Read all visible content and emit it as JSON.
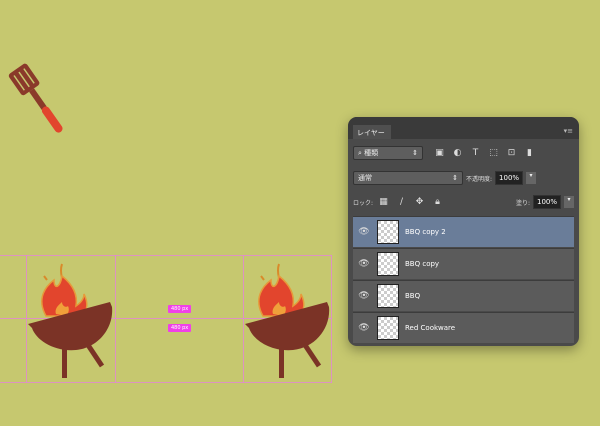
{
  "canvas": {
    "guide_labels": [
      "480 px",
      "480 px"
    ]
  },
  "panel": {
    "tab": "レイヤー",
    "menu_icon": "panel-menu-icon",
    "filter_kind": "種類",
    "blend_mode": "通常",
    "opacity_label": "不透明度:",
    "opacity_value": "100%",
    "lock_label": "ロック:",
    "fill_label": "塗り:",
    "fill_value": "100%",
    "layers": [
      {
        "name": "BBQ copy 2",
        "selected": true
      },
      {
        "name": "BBQ copy",
        "selected": false
      },
      {
        "name": "BBQ",
        "selected": false
      },
      {
        "name": "Red Cookware",
        "selected": false
      }
    ]
  },
  "colors": {
    "background": "#c6c86f",
    "grill": "#7b3326",
    "flame": "#e2452d",
    "guide": "#e08ad0",
    "selected_layer": "#6a7d99"
  }
}
